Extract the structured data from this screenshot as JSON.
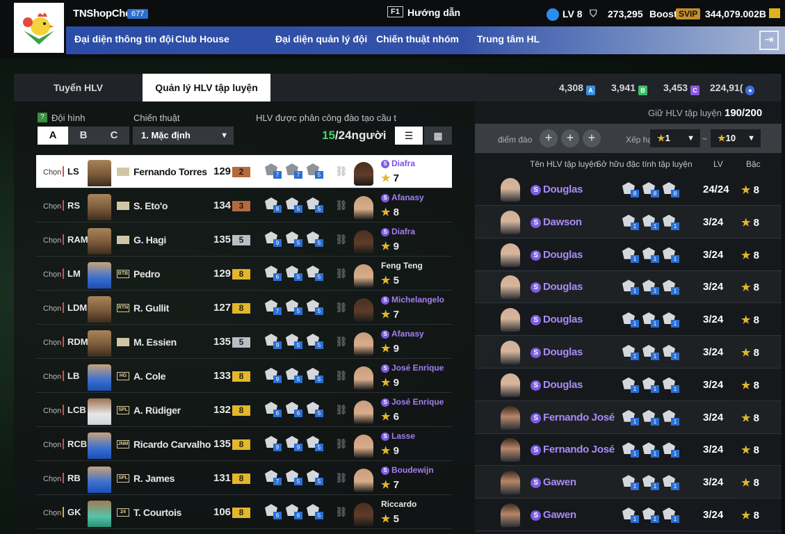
{
  "user": {
    "name": "TNShopChe",
    "level_badge": "677"
  },
  "nav": [
    "Đại diện thông tin đội",
    "Club House",
    "Đại diện quản lý đội",
    "Chiến thuật nhóm",
    "Trung tâm HL"
  ],
  "help": {
    "key": "F1",
    "label": "Hướng dẫn"
  },
  "stats": {
    "lv": "LV 8",
    "currency": "273,295",
    "boost": "Boost",
    "svip": "SVIP",
    "bp": "344,079.002B"
  },
  "tabs": [
    "Tuyển HLV",
    "Quản lý HLV tập luyện"
  ],
  "resources": [
    "4,308",
    "3,941",
    "3,453",
    "224,91("
  ],
  "left": {
    "formation_label": "Đội hình",
    "tactic_label": "Chiến thuật",
    "assign_label": "HLV được phân công đào tạo cầu t",
    "formation_btns": [
      "A",
      "B",
      "C"
    ],
    "tactic_value": "1. Mặc định",
    "count_current": "15",
    "count_rest": "/24người"
  },
  "rows": [
    {
      "chon": "Chọn",
      "pos": "LS",
      "name": "Fernando Torres",
      "season": "",
      "ovr": "129",
      "grade": "2",
      "gtype": "bronze",
      "icons": [
        "7",
        "7",
        "5"
      ],
      "coach": "Diafra",
      "clv": "7",
      "special": true,
      "ph": "skin",
      "cph": "dark"
    },
    {
      "chon": "Chọn",
      "pos": "RS",
      "name": "S. Eto'o",
      "season": "",
      "ovr": "134",
      "grade": "3",
      "gtype": "bronze",
      "icons": [
        "8",
        "5",
        "5"
      ],
      "coach": "Afanasy",
      "clv": "8",
      "special": true,
      "ph": "skin",
      "cph": "light"
    },
    {
      "chon": "Chọn",
      "pos": "RAM",
      "name": "G. Hagi",
      "season": "",
      "ovr": "135",
      "grade": "5",
      "gtype": "silver",
      "icons": [
        "9",
        "5",
        "5"
      ],
      "coach": "Diafra",
      "clv": "9",
      "special": true,
      "ph": "skin",
      "cph": "dark"
    },
    {
      "chon": "Chọn",
      "pos": "LM",
      "name": "Pedro",
      "season": "BTB",
      "ovr": "129",
      "grade": "8",
      "gtype": "gold",
      "icons": [
        "6",
        "5",
        "5"
      ],
      "coach": "Feng Teng",
      "clv": "5",
      "special": false,
      "ph": "blue",
      "cph": "light"
    },
    {
      "chon": "Chọn",
      "pos": "LDM",
      "name": "R. Gullit",
      "season": "RTN",
      "ovr": "127",
      "grade": "8",
      "gtype": "gold",
      "icons": [
        "7",
        "5",
        "5"
      ],
      "coach": "Michelangelo",
      "clv": "7",
      "special": true,
      "ph": "skin",
      "cph": "dark"
    },
    {
      "chon": "Chọn",
      "pos": "RDM",
      "name": "M. Essien",
      "season": "",
      "ovr": "135",
      "grade": "5",
      "gtype": "silver",
      "icons": [
        "9",
        "5",
        "5"
      ],
      "coach": "Afanasy",
      "clv": "9",
      "special": true,
      "ph": "skin",
      "cph": "light"
    },
    {
      "chon": "Chọn",
      "pos": "LB",
      "name": "A. Cole",
      "season": "HG",
      "ovr": "133",
      "grade": "8",
      "gtype": "gold",
      "icons": [
        "9",
        "5",
        "5"
      ],
      "coach": "José Enrique",
      "clv": "9",
      "special": true,
      "ph": "blue",
      "cph": "light"
    },
    {
      "chon": "Chọn",
      "pos": "LCB",
      "name": "A. Rüdiger",
      "season": "SPL",
      "ovr": "132",
      "grade": "8",
      "gtype": "gold",
      "icons": [
        "6",
        "6",
        "5"
      ],
      "coach": "José Enrique",
      "clv": "6",
      "special": true,
      "ph": "white",
      "cph": "light"
    },
    {
      "chon": "Chọn",
      "pos": "RCB",
      "name": "Ricardo Carvalho",
      "season": "JNM",
      "ovr": "135",
      "grade": "8",
      "gtype": "gold",
      "icons": [
        "9",
        "9",
        "5"
      ],
      "coach": "Lasse",
      "clv": "9",
      "special": true,
      "ph": "blue",
      "cph": "light"
    },
    {
      "chon": "Chọn",
      "pos": "RB",
      "name": "R. James",
      "season": "SPL",
      "ovr": "131",
      "grade": "8",
      "gtype": "gold",
      "icons": [
        "7",
        "5",
        "5"
      ],
      "coach": "Boudewijn",
      "clv": "7",
      "special": true,
      "ph": "blue",
      "cph": "light"
    },
    {
      "chon": "Chọn",
      "pos": "GK",
      "name": "T. Courtois",
      "season": "24",
      "ovr": "106",
      "grade": "8",
      "gtype": "gold",
      "icons": [
        "6",
        "6",
        "5"
      ],
      "coach": "Riccardo",
      "clv": "5",
      "special": false,
      "ph": "green",
      "cph": "dark"
    }
  ],
  "right": {
    "hold_label": "Giữ HLV tập luyện",
    "hold_value": "190/200",
    "filter_label": "điểm đào",
    "rank_label": "Xếp hạ",
    "rank_from": "1",
    "rank_sep": "~",
    "rank_to": "10",
    "col_name": "Tên HLV tập luyện",
    "col_trait": "Sở hữu đặc tính tập luyện",
    "col_lv": "LV",
    "col_grade": "Bậc",
    "coaches": [
      {
        "name": "Douglas",
        "icons": [
          "8",
          "8",
          "8"
        ],
        "lv": "24/24",
        "grade": "8",
        "dark": false
      },
      {
        "name": "Dawson",
        "icons": [
          "1",
          "1",
          "1"
        ],
        "lv": "3/24",
        "grade": "8",
        "dark": false
      },
      {
        "name": "Douglas",
        "icons": [
          "1",
          "1",
          "1"
        ],
        "lv": "3/24",
        "grade": "8",
        "dark": false
      },
      {
        "name": "Douglas",
        "icons": [
          "1",
          "1",
          "1"
        ],
        "lv": "3/24",
        "grade": "8",
        "dark": false
      },
      {
        "name": "Douglas",
        "icons": [
          "1",
          "1",
          "1"
        ],
        "lv": "3/24",
        "grade": "8",
        "dark": false
      },
      {
        "name": "Douglas",
        "icons": [
          "1",
          "1",
          "1"
        ],
        "lv": "3/24",
        "grade": "8",
        "dark": false
      },
      {
        "name": "Douglas",
        "icons": [
          "1",
          "1",
          "1"
        ],
        "lv": "3/24",
        "grade": "8",
        "dark": false
      },
      {
        "name": "Fernando José",
        "icons": [
          "1",
          "1",
          "1"
        ],
        "lv": "3/24",
        "grade": "8",
        "dark": true
      },
      {
        "name": "Fernando José",
        "icons": [
          "1",
          "1",
          "1"
        ],
        "lv": "3/24",
        "grade": "8",
        "dark": true
      },
      {
        "name": "Gawen",
        "icons": [
          "1",
          "1",
          "1"
        ],
        "lv": "3/24",
        "grade": "8",
        "dark": true
      },
      {
        "name": "Gawen",
        "icons": [
          "1",
          "1",
          "1"
        ],
        "lv": "3/24",
        "grade": "8",
        "dark": true
      }
    ]
  }
}
